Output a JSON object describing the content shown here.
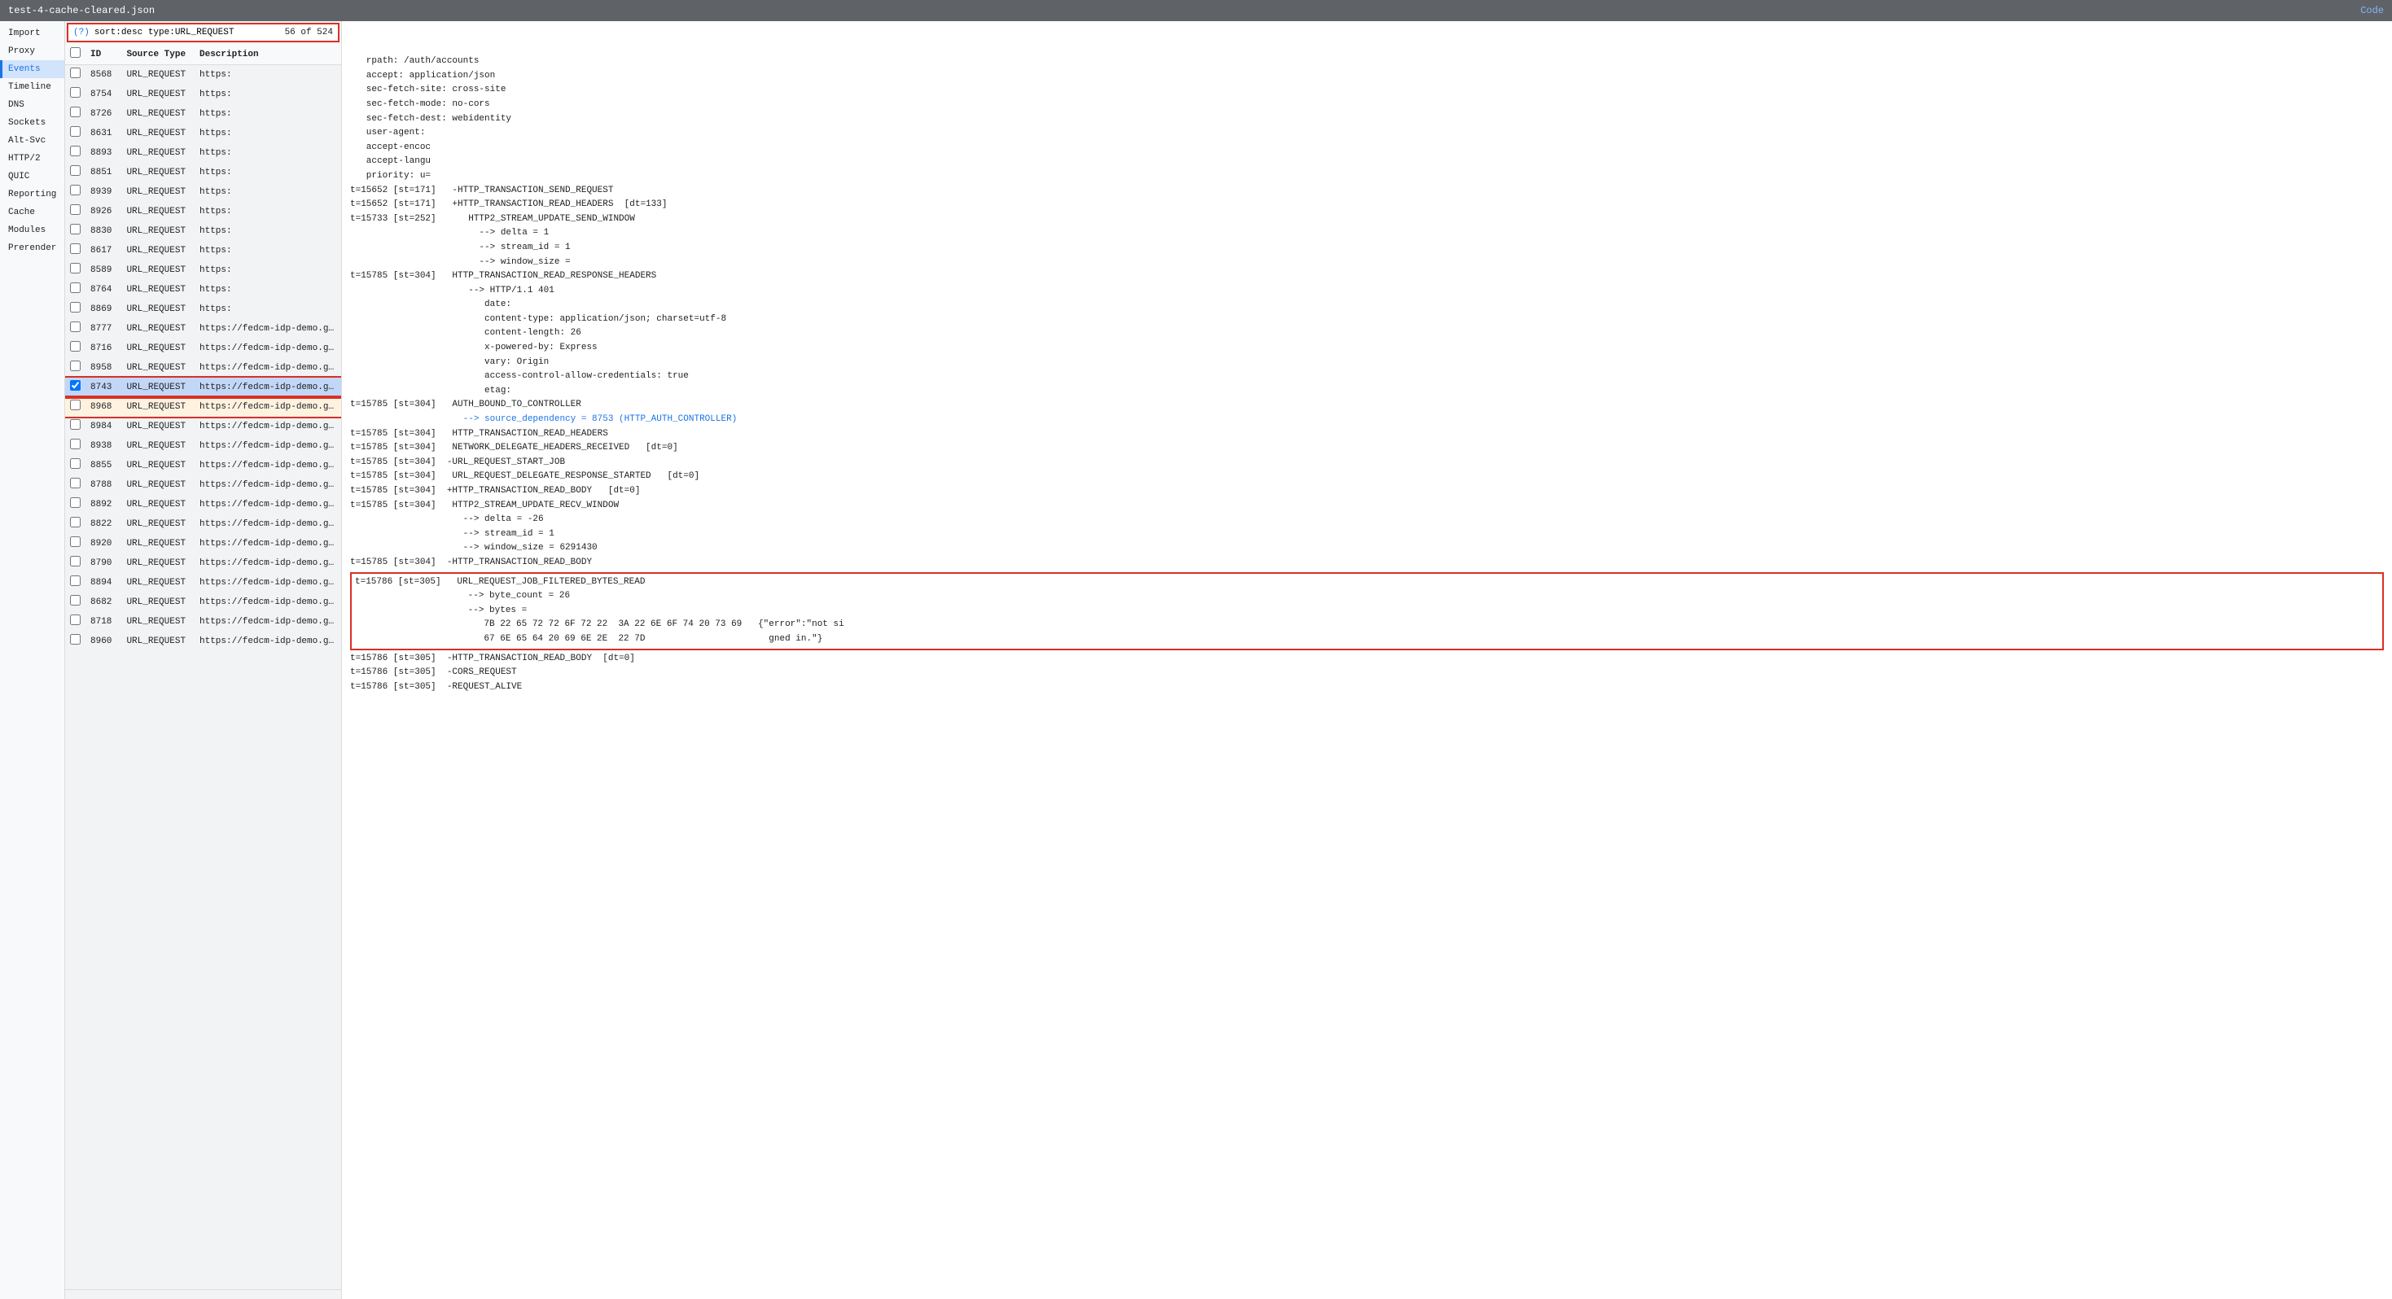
{
  "titleBar": {
    "filename": "test-4-cache-cleared.json",
    "codeLink": "Code"
  },
  "sidebar": {
    "items": [
      {
        "id": "import",
        "label": "Import"
      },
      {
        "id": "proxy",
        "label": "Proxy"
      },
      {
        "id": "events",
        "label": "Events",
        "active": true
      },
      {
        "id": "timeline",
        "label": "Timeline"
      },
      {
        "id": "dns",
        "label": "DNS"
      },
      {
        "id": "sockets",
        "label": "Sockets"
      },
      {
        "id": "alt-svc",
        "label": "Alt-Svc"
      },
      {
        "id": "http2",
        "label": "HTTP/2"
      },
      {
        "id": "quic",
        "label": "QUIC"
      },
      {
        "id": "reporting",
        "label": "Reporting"
      },
      {
        "id": "cache",
        "label": "Cache"
      },
      {
        "id": "modules",
        "label": "Modules"
      },
      {
        "id": "prerender",
        "label": "Prerender"
      }
    ]
  },
  "searchBar": {
    "helpLabel": "(?)",
    "value": "sort:desc type:URL_REQUEST",
    "count": "56 of 524"
  },
  "table": {
    "headers": [
      "",
      "ID",
      "Source Type",
      "Description"
    ],
    "rows": [
      {
        "id": "8568",
        "type": "URL_REQUEST",
        "desc": "https:",
        "checked": false,
        "selected": false
      },
      {
        "id": "8754",
        "type": "URL_REQUEST",
        "desc": "https:",
        "checked": false,
        "selected": false
      },
      {
        "id": "8726",
        "type": "URL_REQUEST",
        "desc": "https:",
        "checked": false,
        "selected": false
      },
      {
        "id": "8631",
        "type": "URL_REQUEST",
        "desc": "https:",
        "checked": false,
        "selected": false
      },
      {
        "id": "8893",
        "type": "URL_REQUEST",
        "desc": "https:",
        "checked": false,
        "selected": false
      },
      {
        "id": "8851",
        "type": "URL_REQUEST",
        "desc": "https:",
        "checked": false,
        "selected": false
      },
      {
        "id": "8939",
        "type": "URL_REQUEST",
        "desc": "https:",
        "checked": false,
        "selected": false
      },
      {
        "id": "8926",
        "type": "URL_REQUEST",
        "desc": "https:",
        "checked": false,
        "selected": false
      },
      {
        "id": "8830",
        "type": "URL_REQUEST",
        "desc": "https:",
        "checked": false,
        "selected": false
      },
      {
        "id": "8617",
        "type": "URL_REQUEST",
        "desc": "https:",
        "checked": false,
        "selected": false
      },
      {
        "id": "8589",
        "type": "URL_REQUEST",
        "desc": "https:",
        "checked": false,
        "selected": false
      },
      {
        "id": "8764",
        "type": "URL_REQUEST",
        "desc": "https:",
        "checked": false,
        "selected": false
      },
      {
        "id": "8869",
        "type": "URL_REQUEST",
        "desc": "https:",
        "checked": false,
        "selected": false
      },
      {
        "id": "8777",
        "type": "URL_REQUEST",
        "desc": "https://fedcm-idp-demo.glitch.me/",
        "checked": false,
        "selected": false
      },
      {
        "id": "8716",
        "type": "URL_REQUEST",
        "desc": "https://fedcm-idp-demo.glitch.me/.well-known/web-ider",
        "checked": false,
        "selected": false
      },
      {
        "id": "8958",
        "type": "URL_REQUEST",
        "desc": "https://fedcm-idp-demo.glitch.me/.well-known/web-ider",
        "checked": false,
        "selected": false
      },
      {
        "id": "8743",
        "type": "URL_REQUEST",
        "desc": "https://fedcm-idp-demo.glitch.me/auth/accounts",
        "checked": true,
        "selected": true
      },
      {
        "id": "8968",
        "type": "URL_REQUEST",
        "desc": "https://fedcm-idp-demo.glitch.me/auth/accounts",
        "checked": false,
        "selected": false,
        "inRange": true
      },
      {
        "id": "8984",
        "type": "URL_REQUEST",
        "desc": "https://fedcm-idp-demo.glitch.me/auth/idtokens",
        "checked": false,
        "selected": false
      },
      {
        "id": "8938",
        "type": "URL_REQUEST",
        "desc": "https://fedcm-idp-demo.glitch.me/auth/password",
        "checked": false,
        "selected": false
      },
      {
        "id": "8855",
        "type": "URL_REQUEST",
        "desc": "https://fedcm-idp-demo.glitch.me/auth/username",
        "checked": false,
        "selected": false
      },
      {
        "id": "8788",
        "type": "URL_REQUEST",
        "desc": "https://fedcm-idp-demo.glitch.me/bundle.css",
        "checked": false,
        "selected": false
      },
      {
        "id": "8892",
        "type": "URL_REQUEST",
        "desc": "https://fedcm-idp-demo.glitch.me/bundle.css",
        "checked": false,
        "selected": false
      },
      {
        "id": "8822",
        "type": "URL_REQUEST",
        "desc": "https://fedcm-idp-demo.glitch.me/client.js",
        "checked": false,
        "selected": false
      },
      {
        "id": "8920",
        "type": "URL_REQUEST",
        "desc": "https://fedcm-idp-demo.glitch.me/client.js",
        "checked": false,
        "selected": false
      },
      {
        "id": "8790",
        "type": "URL_REQUEST",
        "desc": "https://fedcm-idp-demo.glitch.me/components-bundle.j",
        "checked": false,
        "selected": false
      },
      {
        "id": "8894",
        "type": "URL_REQUEST",
        "desc": "https://fedcm-idp-demo.glitch.me/components-bundle.j",
        "checked": false,
        "selected": false
      },
      {
        "id": "8682",
        "type": "URL_REQUEST",
        "desc": "https://fedcm-idp-demo.glitch.me/fedcm.js",
        "checked": false,
        "selected": false
      },
      {
        "id": "8718",
        "type": "URL_REQUEST",
        "desc": "https://fedcm-idp-demo.glitch.me/fedcm.json",
        "checked": false,
        "selected": false
      },
      {
        "id": "8960",
        "type": "URL_REQUEST",
        "desc": "https://fedcm-idp-demo.glitch.me/fedcm.json",
        "checked": false,
        "selected": false
      }
    ]
  },
  "detail": {
    "lines": [
      {
        "text": "   rpath: /auth/accounts",
        "type": "normal"
      },
      {
        "text": "   accept: application/json",
        "type": "normal"
      },
      {
        "text": "   sec-fetch-site: cross-site",
        "type": "normal"
      },
      {
        "text": "   sec-fetch-mode: no-cors",
        "type": "normal"
      },
      {
        "text": "   sec-fetch-dest: webidentity",
        "type": "normal"
      },
      {
        "text": "   user-agent:",
        "type": "normal"
      },
      {
        "text": "   accept-encoc",
        "type": "normal"
      },
      {
        "text": "   accept-langu",
        "type": "normal"
      },
      {
        "text": "   priority: u=",
        "type": "normal"
      },
      {
        "text": "t=15652 [st=171]   -HTTP_TRANSACTION_SEND_REQUEST",
        "type": "normal"
      },
      {
        "text": "t=15652 [st=171]   +HTTP_TRANSACTION_READ_HEADERS  [dt=133]",
        "type": "normal"
      },
      {
        "text": "t=15733 [st=252]      HTTP2_STREAM_UPDATE_SEND_WINDOW",
        "type": "normal"
      },
      {
        "text": "                        --> delta = 1",
        "type": "normal"
      },
      {
        "text": "                        --> stream_id = 1",
        "type": "normal"
      },
      {
        "text": "                        --> window_size =",
        "type": "normal"
      },
      {
        "text": "t=15785 [st=304]   HTTP_TRANSACTION_READ_RESPONSE_HEADERS",
        "type": "normal"
      },
      {
        "text": "                      --> HTTP/1.1 401",
        "type": "normal"
      },
      {
        "text": "                         date:",
        "type": "normal"
      },
      {
        "text": "                         content-type: application/json; charset=utf-8",
        "type": "normal"
      },
      {
        "text": "                         content-length: 26",
        "type": "normal"
      },
      {
        "text": "                         x-powered-by: Express",
        "type": "normal"
      },
      {
        "text": "                         vary: Origin",
        "type": "normal"
      },
      {
        "text": "                         access-control-allow-credentials: true",
        "type": "normal"
      },
      {
        "text": "                         etag:",
        "type": "normal"
      },
      {
        "text": "t=15785 [st=304]   AUTH_BOUND_TO_CONTROLLER",
        "type": "normal"
      },
      {
        "text": "                     --> source_dependency = 8753 (HTTP_AUTH_CONTROLLER)",
        "type": "highlight"
      },
      {
        "text": "t=15785 [st=304]   HTTP_TRANSACTION_READ_HEADERS",
        "type": "normal"
      },
      {
        "text": "t=15785 [st=304]   NETWORK_DELEGATE_HEADERS_RECEIVED   [dt=0]",
        "type": "normal"
      },
      {
        "text": "t=15785 [st=304]  -URL_REQUEST_START_JOB",
        "type": "normal"
      },
      {
        "text": "t=15785 [st=304]   URL_REQUEST_DELEGATE_RESPONSE_STARTED   [dt=0]",
        "type": "normal"
      },
      {
        "text": "t=15785 [st=304]  +HTTP_TRANSACTION_READ_BODY   [dt=0]",
        "type": "normal"
      },
      {
        "text": "t=15785 [st=304]   HTTP2_STREAM_UPDATE_RECV_WINDOW",
        "type": "normal"
      },
      {
        "text": "                     --> delta = -26",
        "type": "normal"
      },
      {
        "text": "                     --> stream_id = 1",
        "type": "normal"
      },
      {
        "text": "                     --> window_size = 6291430",
        "type": "normal"
      },
      {
        "text": "t=15785 [st=304]  -HTTP_TRANSACTION_READ_BODY",
        "type": "normal"
      },
      {
        "text": "t=15786 [st=305]   URL_REQUEST_JOB_FILTERED_BYTES_READ",
        "type": "boxed-start"
      },
      {
        "text": "                     --> byte_count = 26",
        "type": "boxed"
      },
      {
        "text": "                     --> bytes =",
        "type": "boxed"
      },
      {
        "text": "                        7B 22 65 72 72 6F 72 22  3A 22 6E 6F 74 20 73 69   {\"error\":\"not si",
        "type": "boxed"
      },
      {
        "text": "                        67 6E 65 64 20 69 6E 2E  22 7D                       gned in.\"}",
        "type": "boxed-end"
      },
      {
        "text": "t=15786 [st=305]  -HTTP_TRANSACTION_READ_BODY  [dt=0]",
        "type": "normal"
      },
      {
        "text": "t=15786 [st=305]  -CORS_REQUEST",
        "type": "normal"
      },
      {
        "text": "t=15786 [st=305]  -REQUEST_ALIVE",
        "type": "normal"
      }
    ]
  }
}
